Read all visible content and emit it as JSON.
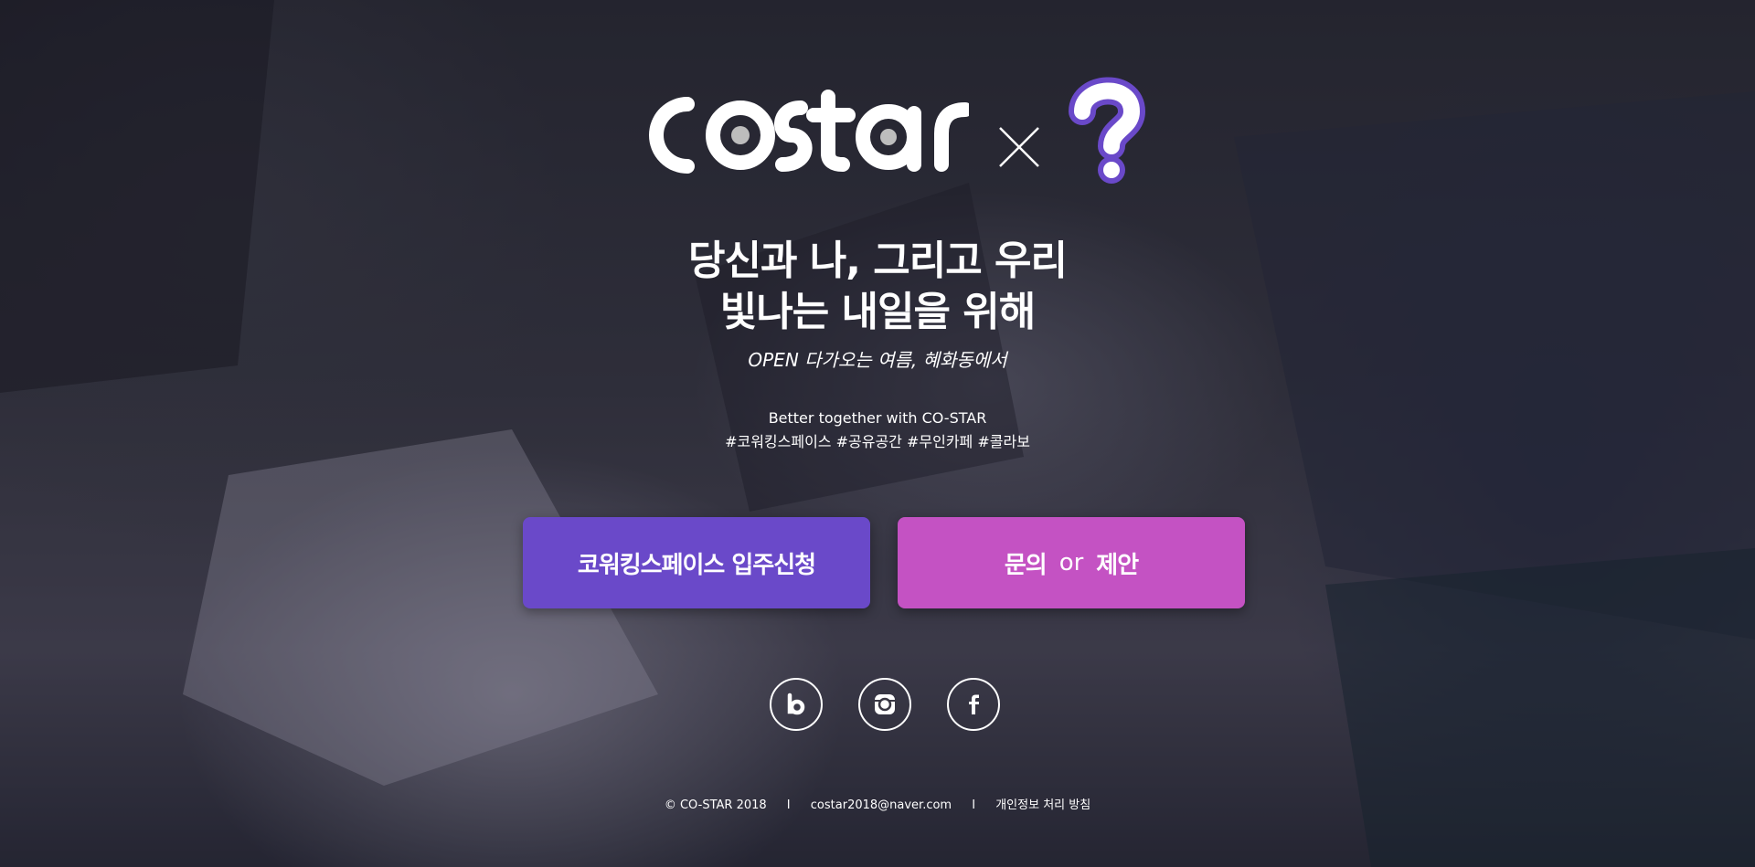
{
  "logo": {
    "brand_text": "costar",
    "times_symbol": "×",
    "mystery_symbol": "?",
    "accent_purple": "#6a49c9"
  },
  "hero": {
    "headline_line1": "당신과 나, 그리고 우리",
    "headline_line2": "빛나는 내일을 위해",
    "subline": "OPEN 다가오는 여름, 혜화동에서",
    "tagline_line1": "Better together with CO-STAR",
    "tagline_line2": "#코워킹스페이스 #공유공간 #무인카페 #콜라보"
  },
  "buttons": {
    "apply_label": "코워킹스페이스 입주신청",
    "apply_color": "#6a49c9",
    "contact_left": "문의",
    "contact_or": "or",
    "contact_right": "제안",
    "contact_color": "#c452c3"
  },
  "social": {
    "icons": [
      "blog-icon",
      "instagram-icon",
      "facebook-icon"
    ]
  },
  "footer": {
    "copyright": "© CO-STAR 2018",
    "separator": "I",
    "email": "costar2018@naver.com",
    "privacy": "개인정보 처리 방침"
  }
}
